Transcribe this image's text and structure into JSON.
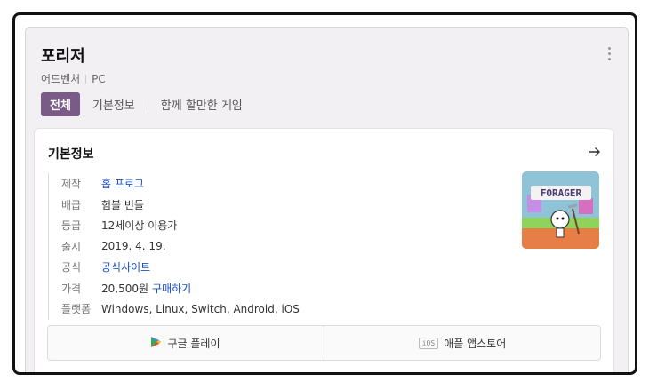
{
  "game": {
    "title": "포리저",
    "genre": "어드벤처",
    "platform": "PC"
  },
  "tabs": [
    {
      "label": "전체",
      "active": true
    },
    {
      "label": "기본정보",
      "active": false
    },
    {
      "label": "함께 할만한 게임",
      "active": false
    }
  ],
  "panel": {
    "title": "기본정보"
  },
  "info": [
    {
      "label": "제작",
      "value": "홉 프로그",
      "is_link": true
    },
    {
      "label": "배급",
      "value": "험블 번들",
      "is_link": false
    },
    {
      "label": "등급",
      "value": "12세이상 이용가",
      "is_link": false
    },
    {
      "label": "출시",
      "value": "2019. 4. 19.",
      "is_link": false
    },
    {
      "label": "공식",
      "value": "공식사이트",
      "is_link": true
    },
    {
      "label": "가격",
      "value": "20,500원",
      "is_link": false,
      "link_text": "구매하기"
    },
    {
      "label": "플랫폼",
      "value": "Windows, Linux, Switch, Android, iOS",
      "is_link": false
    }
  ],
  "stores": {
    "google_label": "구글 플레이",
    "apple_badge": "iOS",
    "apple_label": "애플 앱스토어"
  },
  "colors": {
    "accent": "#7a5a86",
    "link": "#1a4fc4"
  },
  "icons": [
    "more-vertical-icon",
    "arrow-right-icon",
    "google-play-icon",
    "ios-badge-icon"
  ]
}
